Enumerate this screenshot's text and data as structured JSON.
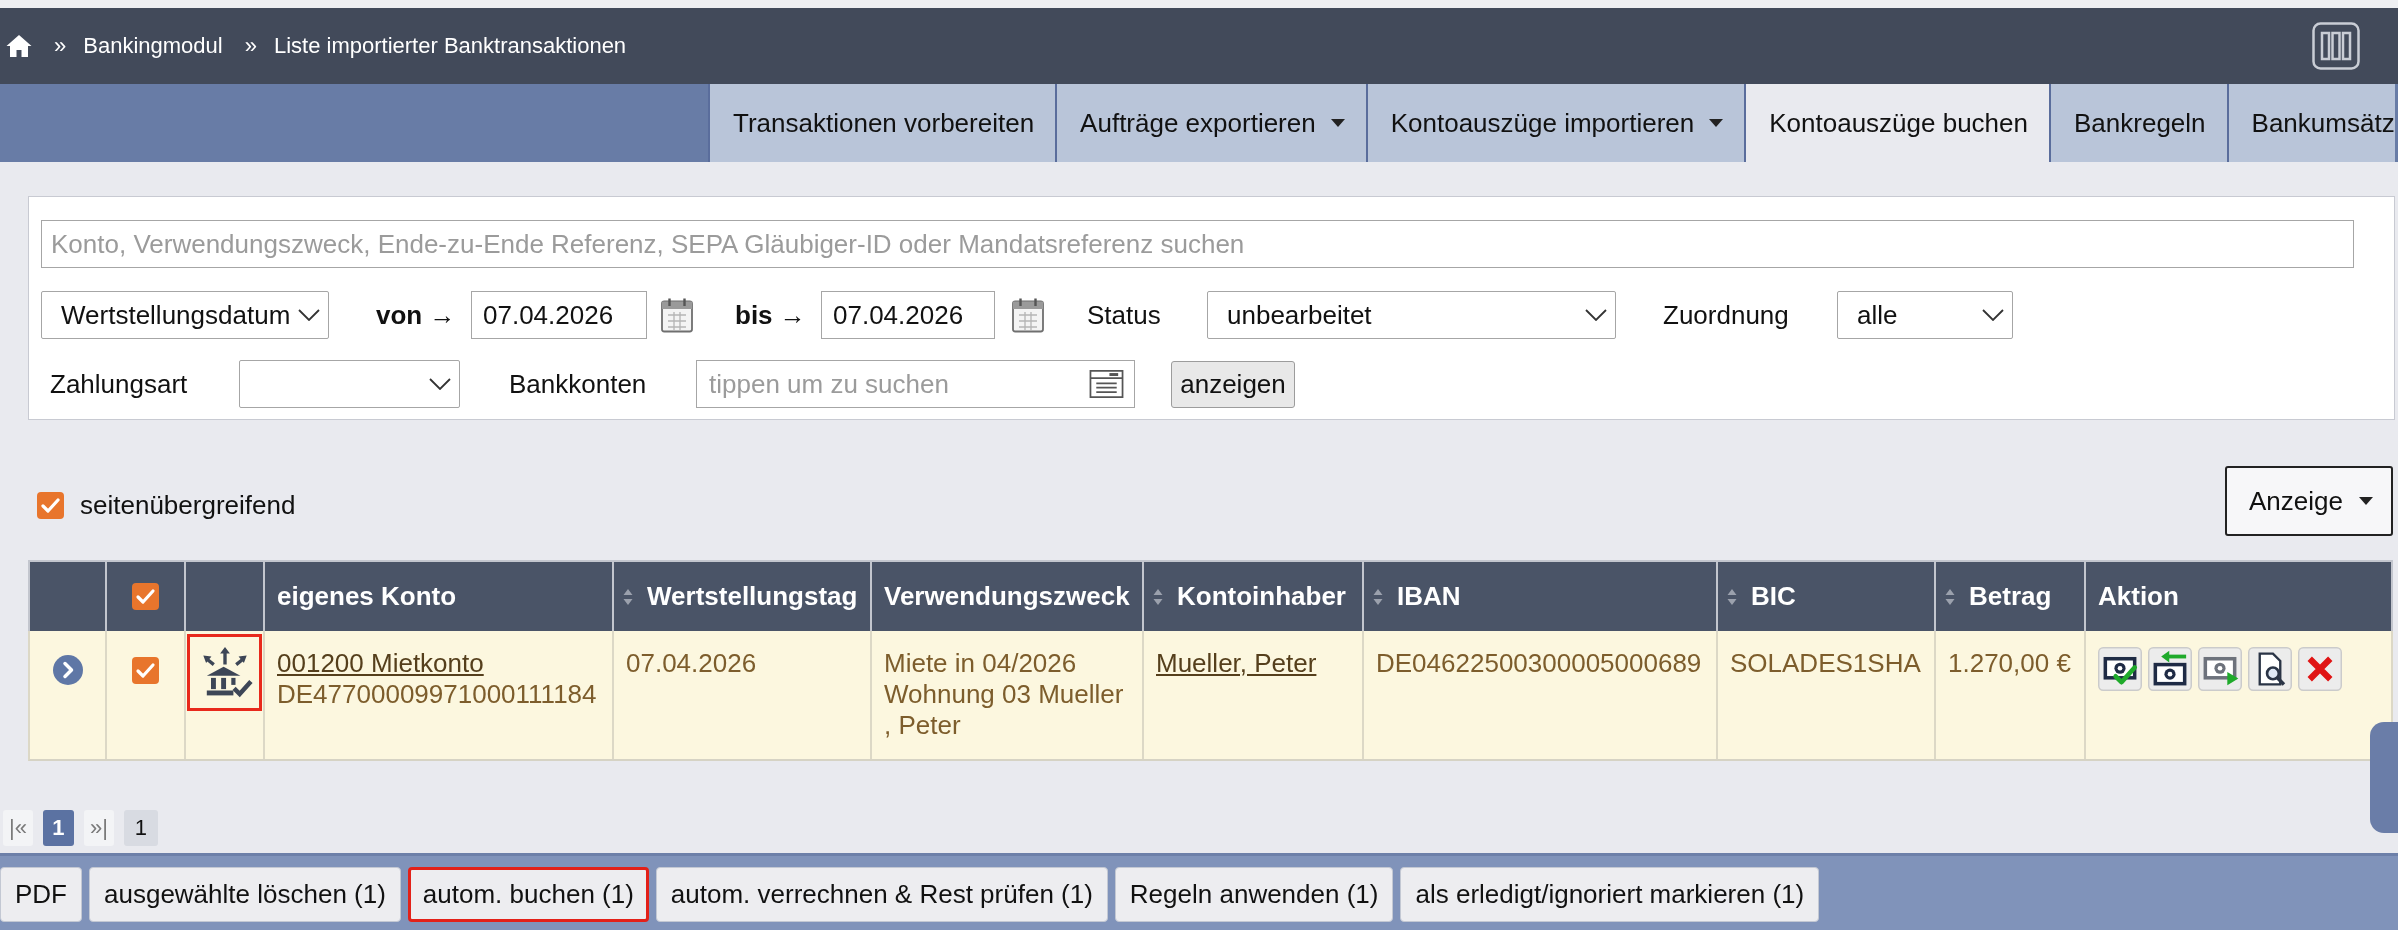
{
  "header": {
    "breadcrumb": [
      {
        "separator": "»",
        "label": "Bankingmodul"
      },
      {
        "separator": "»",
        "label": "Liste importierter Banktransaktionen"
      }
    ]
  },
  "tabs": [
    {
      "label": "Transaktionen vorbereiten",
      "selected": false,
      "dropdown": false
    },
    {
      "label": "Aufträge exportieren",
      "selected": false,
      "dropdown": true
    },
    {
      "label": "Kontoauszüge importieren",
      "selected": false,
      "dropdown": true
    },
    {
      "label": "Kontoauszüge buchen",
      "selected": true,
      "dropdown": false
    },
    {
      "label": "Bankregeln",
      "selected": false,
      "dropdown": false
    },
    {
      "label": "Bankumsätz",
      "selected": false,
      "dropdown": false
    }
  ],
  "filters": {
    "search": {
      "placeholder": "Konto, Verwendungszweck, Ende-zu-Ende Referenz, SEPA Gläubiger-ID oder Mandatsreferenz suchen"
    },
    "date_field": {
      "value": "Wertstellungsdatum"
    },
    "date_from": {
      "label": "von →",
      "value": "07.04.2026"
    },
    "date_to": {
      "label": "bis →",
      "value": "07.04.2026"
    },
    "status": {
      "label": "Status",
      "value": "unbearbeitet"
    },
    "assignment": {
      "label": "Zuordnung",
      "value": "alle"
    },
    "payment_type": {
      "label": "Zahlungsart"
    },
    "bank_accounts": {
      "label": "Bankkonten",
      "placeholder": "tippen um zu suchen"
    },
    "submit_button": {
      "label": "anzeigen"
    }
  },
  "across_pages": {
    "label": "seitenübergreifend",
    "checked": true
  },
  "display_menu": {
    "label": "Anzeige"
  },
  "table": {
    "columns": [
      {
        "kind": "expand"
      },
      {
        "kind": "select",
        "checked": true
      },
      {
        "kind": "icon"
      },
      {
        "kind": "text",
        "label": "eigenes Konto",
        "sortable": false
      },
      {
        "kind": "text",
        "label": "Wertstellungstag",
        "sortable": true
      },
      {
        "kind": "text",
        "label": "Verwendungszweck",
        "sortable": false
      },
      {
        "kind": "text",
        "label": "Kontoinhaber",
        "sortable": true
      },
      {
        "kind": "text",
        "label": "IBAN",
        "sortable": true
      },
      {
        "kind": "text",
        "label": "BIC",
        "sortable": true
      },
      {
        "kind": "text",
        "label": "Betrag",
        "sortable": true
      },
      {
        "kind": "text",
        "label": "Aktion",
        "sortable": false
      }
    ],
    "rows": [
      {
        "cells": [
          {
            "kind": "expand",
            "expanded": false
          },
          {
            "kind": "check",
            "checked": true
          },
          {
            "kind": "status_icon",
            "highlighted": true
          },
          {
            "kind": "account",
            "link": "001200 Mietkonto",
            "text": "DE47700009971000111184"
          },
          {
            "kind": "text",
            "text": "07.04.2026"
          },
          {
            "kind": "lines",
            "lines": [
              "Miete in 04/2026",
              "Wohnung 03 Mueller",
              ", Peter"
            ]
          },
          {
            "kind": "link",
            "text": "Mueller, Peter"
          },
          {
            "kind": "text",
            "text": "DE04622500300005000689"
          },
          {
            "kind": "text",
            "text": "SOLADES1SHA"
          },
          {
            "kind": "text",
            "text": "1.270,00 €"
          },
          {
            "kind": "actions",
            "actions": [
              {
                "kind": "book"
              },
              {
                "kind": "return"
              },
              {
                "kind": "forward"
              },
              {
                "kind": "inspect"
              },
              {
                "kind": "delete"
              }
            ]
          }
        ]
      }
    ]
  },
  "pagination": {
    "first": "|«",
    "pages": [
      {
        "label": "1",
        "selected": true
      }
    ],
    "last": "»|",
    "total": "1"
  },
  "bottom_bar": {
    "buttons": [
      {
        "label": "PDF",
        "highlighted": false
      },
      {
        "label": "ausgewählte löschen (1)",
        "highlighted": false
      },
      {
        "label": "autom. buchen (1)",
        "highlighted": true
      },
      {
        "label": "autom. verrechnen & Rest prüfen (1)",
        "highlighted": false
      },
      {
        "label": "Regeln anwenden (1)",
        "highlighted": false
      },
      {
        "label": "als erledigt/ignoriert markieren (1)",
        "highlighted": false
      }
    ]
  }
}
